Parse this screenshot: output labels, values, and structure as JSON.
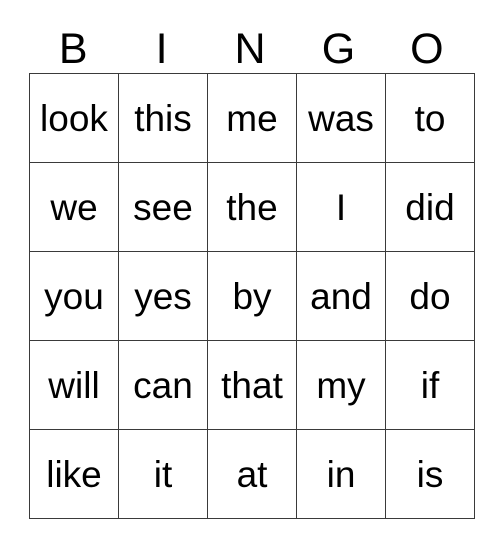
{
  "card": {
    "header_letters": [
      "B",
      "I",
      "N",
      "G",
      "O"
    ],
    "rows": [
      [
        "look",
        "this",
        "me",
        "was",
        "to"
      ],
      [
        "we",
        "see",
        "the",
        "I",
        "did"
      ],
      [
        "you",
        "yes",
        "by",
        "and",
        "do"
      ],
      [
        "will",
        "can",
        "that",
        "my",
        "if"
      ],
      [
        "like",
        "it",
        "at",
        "in",
        "is"
      ]
    ],
    "colors": {
      "background": "#ffffff",
      "text": "#000000",
      "grid_line": "#3a3a3a"
    }
  }
}
